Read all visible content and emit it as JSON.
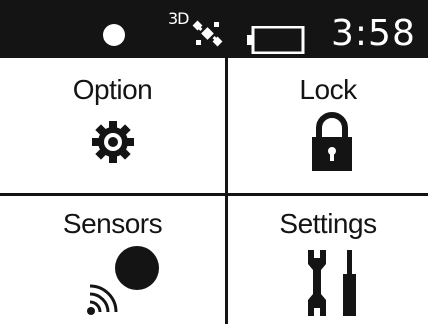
{
  "status": {
    "gps_label": "3D",
    "time": "3:58",
    "icons": [
      "record-dot-icon",
      "gps-satellite-icon",
      "battery-icon"
    ]
  },
  "menu": {
    "items": [
      {
        "label": "Option",
        "icon": "gear-icon"
      },
      {
        "label": "Lock",
        "icon": "padlock-icon"
      },
      {
        "label": "Sensors",
        "icon": "wireless-sensor-icon"
      },
      {
        "label": "Settings",
        "icon": "wrench-screwdriver-icon"
      }
    ]
  },
  "colors": {
    "foreground": "#141414",
    "background": "#ffffff"
  }
}
